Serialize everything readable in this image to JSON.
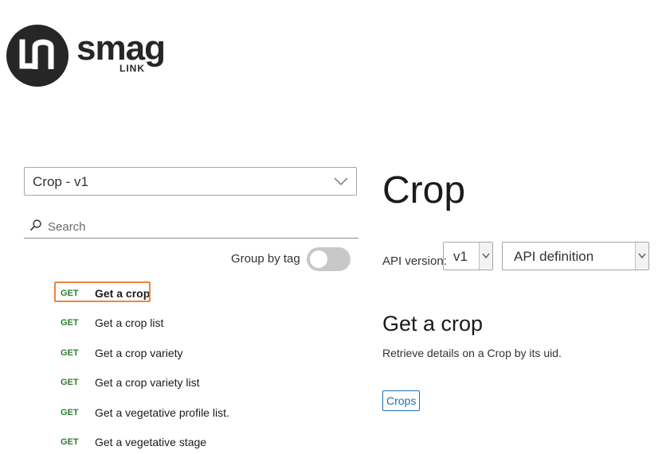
{
  "brand": {
    "name": "smag",
    "sub": "LINK",
    "logo_mark": "LN"
  },
  "sidebar": {
    "api_selector": "Crop - v1",
    "search_placeholder": "Search",
    "group_by_tag_label": "Group by tag",
    "group_by_tag_on": false,
    "operations": [
      {
        "verb": "GET",
        "label": "Get a crop",
        "active": true
      },
      {
        "verb": "GET",
        "label": "Get a crop list"
      },
      {
        "verb": "GET",
        "label": "Get a crop variety"
      },
      {
        "verb": "GET",
        "label": "Get a crop variety list"
      },
      {
        "verb": "GET",
        "label": "Get a vegetative profile list."
      },
      {
        "verb": "GET",
        "label": "Get a vegetative stage"
      }
    ]
  },
  "main": {
    "title": "Crop",
    "api_version_label": "API version:",
    "api_version_value": "v1",
    "definition_select": "API definition",
    "operation": {
      "title": "Get a crop",
      "description": "Retrieve details on a Crop by its uid.",
      "tag": "Crops"
    }
  },
  "colors": {
    "get_verb": "#2e7d32",
    "active_outline": "#f0843c",
    "tag_blue": "#1f6fb2"
  }
}
